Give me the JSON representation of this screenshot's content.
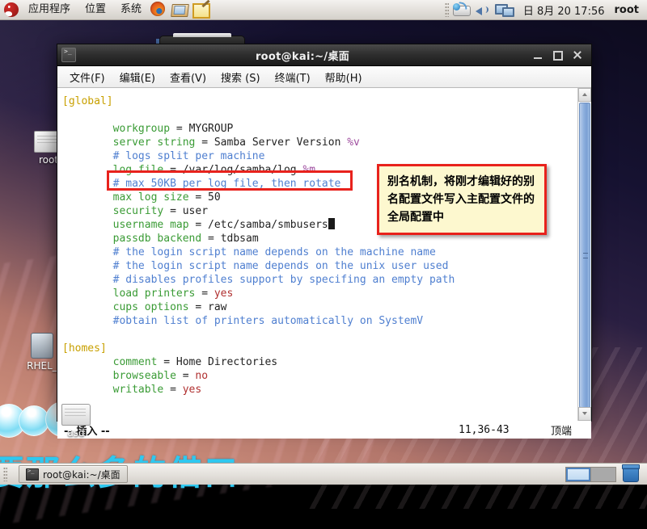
{
  "top_panel": {
    "logo": "redhat-logo",
    "menus": [
      "应用程序",
      "位置",
      "系统"
    ],
    "launchers": [
      "firefox-icon",
      "help-envelope-icon",
      "text-editor-icon"
    ],
    "tray": [
      "network-icon",
      "volume-icon",
      "display-icon"
    ],
    "clock": "日  8月 20 17:56",
    "user": "root"
  },
  "desktop": {
    "icons": [
      {
        "label": "root",
        "glyph": "folder-icon"
      },
      {
        "label": "RHEL_",
        "glyph": "drive-icon"
      },
      {
        "label": "asd",
        "glyph": "folder-icon"
      }
    ],
    "watermark_text": "要那么多的借口"
  },
  "window": {
    "title": "root@kai:~/桌面",
    "icon": "terminal-icon",
    "buttons": {
      "minimize": "_",
      "maximize": "□",
      "close": "✕"
    },
    "menu": [
      "文件(F)",
      "编辑(E)",
      "查看(V)",
      "搜索 (S)",
      "终端(T)",
      "帮助(H)"
    ]
  },
  "editor": {
    "lines": [
      {
        "indent": 0,
        "parts": [
          {
            "t": "[global]",
            "c": "section"
          }
        ]
      },
      {
        "indent": 0,
        "parts": []
      },
      {
        "indent": 1,
        "parts": [
          {
            "t": "workgroup",
            "c": "key"
          },
          {
            "t": " = ",
            "c": "val"
          },
          {
            "t": "MYGROUP",
            "c": "val"
          }
        ]
      },
      {
        "indent": 1,
        "parts": [
          {
            "t": "server string",
            "c": "key"
          },
          {
            "t": " = ",
            "c": "val"
          },
          {
            "t": "Samba Server Version ",
            "c": "val"
          },
          {
            "t": "%v",
            "c": "special"
          }
        ]
      },
      {
        "indent": 1,
        "parts": [
          {
            "t": "# logs split per machine",
            "c": "comment"
          }
        ]
      },
      {
        "indent": 1,
        "parts": [
          {
            "t": "log file",
            "c": "key"
          },
          {
            "t": " = ",
            "c": "val"
          },
          {
            "t": "/var/log/samba/log.",
            "c": "val"
          },
          {
            "t": "%m",
            "c": "special"
          }
        ]
      },
      {
        "indent": 1,
        "parts": [
          {
            "t": "# max 50KB per log file, then rotate",
            "c": "comment"
          }
        ]
      },
      {
        "indent": 1,
        "parts": [
          {
            "t": "max log size",
            "c": "key"
          },
          {
            "t": " = ",
            "c": "val"
          },
          {
            "t": "50",
            "c": "val"
          }
        ]
      },
      {
        "indent": 1,
        "parts": [
          {
            "t": "security",
            "c": "key"
          },
          {
            "t": " = ",
            "c": "val"
          },
          {
            "t": "user",
            "c": "val"
          }
        ]
      },
      {
        "indent": 1,
        "parts": [
          {
            "t": "username map",
            "c": "key"
          },
          {
            "t": " = ",
            "c": "val"
          },
          {
            "t": "/etc/samba/smbusers",
            "c": "val"
          },
          {
            "t": "",
            "c": "cursor"
          }
        ]
      },
      {
        "indent": 1,
        "parts": [
          {
            "t": "passdb backend",
            "c": "key"
          },
          {
            "t": " = ",
            "c": "val"
          },
          {
            "t": "tdbsam",
            "c": "val"
          }
        ]
      },
      {
        "indent": 1,
        "parts": [
          {
            "t": "# the login script name depends on the machine name",
            "c": "comment"
          }
        ]
      },
      {
        "indent": 1,
        "parts": [
          {
            "t": "# the login script name depends on the unix user used",
            "c": "comment"
          }
        ]
      },
      {
        "indent": 1,
        "parts": [
          {
            "t": "# disables profiles support by specifing an empty path",
            "c": "comment"
          }
        ]
      },
      {
        "indent": 1,
        "parts": [
          {
            "t": "load printers",
            "c": "key"
          },
          {
            "t": " = ",
            "c": "val"
          },
          {
            "t": "yes",
            "c": "str"
          }
        ]
      },
      {
        "indent": 1,
        "parts": [
          {
            "t": "cups options",
            "c": "key"
          },
          {
            "t": " = ",
            "c": "val"
          },
          {
            "t": "raw",
            "c": "val"
          }
        ]
      },
      {
        "indent": 1,
        "parts": [
          {
            "t": "#obtain list of printers automatically on SystemV",
            "c": "comment"
          }
        ]
      },
      {
        "indent": 0,
        "parts": []
      },
      {
        "indent": 0,
        "parts": [
          {
            "t": "[homes]",
            "c": "section"
          }
        ]
      },
      {
        "indent": 1,
        "parts": [
          {
            "t": "comment",
            "c": "key"
          },
          {
            "t": " = ",
            "c": "val"
          },
          {
            "t": "Home Directories",
            "c": "val"
          }
        ]
      },
      {
        "indent": 1,
        "parts": [
          {
            "t": "browseable",
            "c": "key"
          },
          {
            "t": " = ",
            "c": "val"
          },
          {
            "t": "no",
            "c": "str"
          }
        ]
      },
      {
        "indent": 1,
        "parts": [
          {
            "t": "writable",
            "c": "key"
          },
          {
            "t": " = ",
            "c": "val"
          },
          {
            "t": "yes",
            "c": "str"
          }
        ]
      }
    ],
    "status": {
      "mode": "-- 插入 --",
      "position": "11,36-43",
      "scroll": "顶端"
    }
  },
  "annotation": {
    "text": "别名机制，将刚才编辑好的别名配置文件写入主配置文件的全局配置中",
    "border_color": "#e8221c",
    "background_color": "#fdf8cf"
  },
  "highlight": {
    "target_line": "username map = /etc/samba/smbusers",
    "color": "#e8221c"
  },
  "bottom_panel": {
    "task_button": {
      "label": "root@kai:~/桌面",
      "icon": "terminal-icon"
    },
    "workspaces": [
      "workspace-1",
      "workspace-2"
    ],
    "trash": "trash-icon"
  }
}
